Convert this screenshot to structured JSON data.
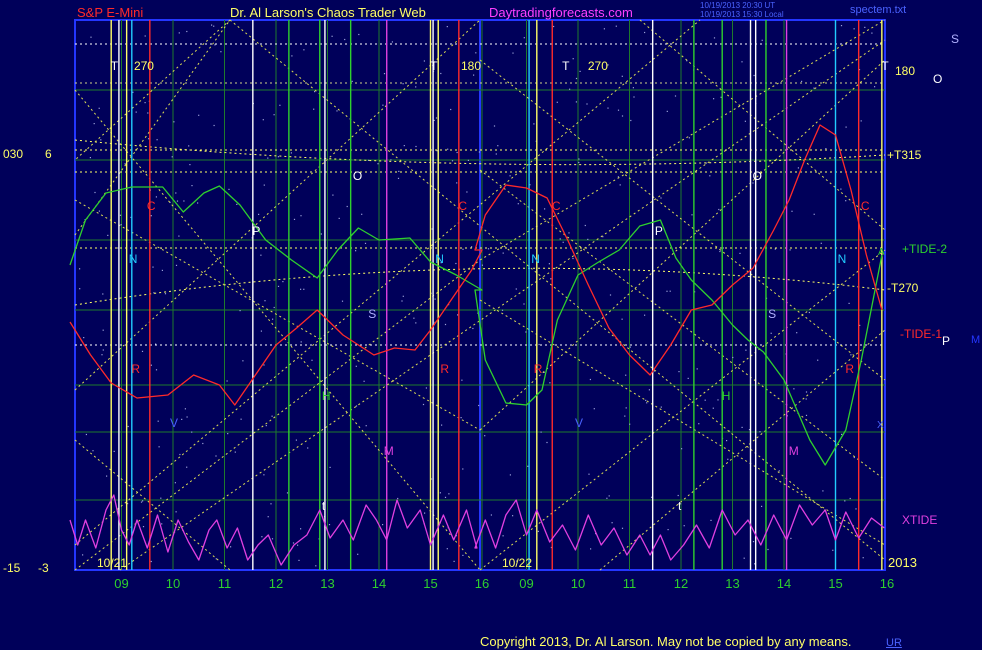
{
  "header": {
    "instrument": "S&P E-Mini",
    "title": "Dr. Al Larson's Chaos Trader Web",
    "site": "Daytradingforecasts.com",
    "stamp1": "10/19/2013 20:30 UT",
    "stamp2": "10/19/2013 15:30 Local",
    "file": "spectem.txt"
  },
  "footer": {
    "copyright": "Copyright 2013, Dr. Al Larson. May not be copied by any means.",
    "link": "UR"
  },
  "colors": {
    "background": "#00005a",
    "frame": "#2436ff",
    "grid": "#1e7a2c",
    "yellow": "#ffff66",
    "red": "#ff2a2a",
    "green": "#2ed02e",
    "magenta": "#e040e0",
    "cyan": "#22ccff",
    "white": "#ffffff"
  },
  "chart_data": {
    "type": "line",
    "x_ticks": [
      "09",
      "10",
      "11",
      "12",
      "13",
      "14",
      "15",
      "16",
      "09",
      "10",
      "11",
      "12",
      "13",
      "14",
      "15",
      "16"
    ],
    "dates": [
      "10/21",
      "10/22"
    ],
    "year": "2013",
    "left_axis": {
      "top_labels": [
        "030",
        "6"
      ],
      "bottom_labels": [
        "-15",
        "-3"
      ]
    },
    "right_labels": {
      "t315": "+T315",
      "tide2": "+TIDE-2",
      "t270": "-T270",
      "tide1": "-TIDE-1",
      "xtide": "XTIDE",
      "s": "S",
      "o": "O",
      "p": "P",
      "m": "M",
      "a": "A",
      "x": "X",
      "t180": "180"
    },
    "vertical_letters": [
      {
        "text": "T",
        "color": "#ffffff",
        "day": 0,
        "hour": 8.85,
        "y": 70
      },
      {
        "text": "270",
        "color": "#ffff66",
        "day": 0,
        "hour": 9.3,
        "y": 70
      },
      {
        "text": "T",
        "color": "#ffffff",
        "day": 0,
        "hour": 15.05,
        "y": 70
      },
      {
        "text": "180",
        "color": "#ffff66",
        "day": 0,
        "hour": 15.65,
        "y": 70
      },
      {
        "text": "T",
        "color": "#ffffff",
        "day": 1,
        "hour": 9.75,
        "y": 70
      },
      {
        "text": "270",
        "color": "#ffff66",
        "day": 1,
        "hour": 10.25,
        "y": 70
      },
      {
        "text": "T",
        "color": "#ffffff",
        "day": 1,
        "hour": 15.95,
        "y": 70
      },
      {
        "text": "O",
        "color": "#ffffff",
        "day": 0,
        "hour": 13.55,
        "y": 180
      },
      {
        "text": "O",
        "color": "#ffffff",
        "day": 1,
        "hour": 13.45,
        "y": 180
      },
      {
        "text": "C",
        "color": "#ff2a2a",
        "day": 0,
        "hour": 9.55,
        "y": 210
      },
      {
        "text": "C",
        "color": "#ff2a2a",
        "day": 0,
        "hour": 15.6,
        "y": 210
      },
      {
        "text": "C",
        "color": "#ff2a2a",
        "day": 1,
        "hour": 9.55,
        "y": 210
      },
      {
        "text": "C",
        "color": "#ff2a2a",
        "day": 1,
        "hour": 15.55,
        "y": 210
      },
      {
        "text": "P",
        "color": "#ffffff",
        "day": 0,
        "hour": 11.6,
        "y": 235
      },
      {
        "text": "P",
        "color": "#ffffff",
        "day": 1,
        "hour": 11.55,
        "y": 235
      },
      {
        "text": "N",
        "color": "#22ccff",
        "day": 0,
        "hour": 9.2,
        "y": 263
      },
      {
        "text": "N",
        "color": "#22ccff",
        "day": 0,
        "hour": 15.15,
        "y": 263
      },
      {
        "text": "N",
        "color": "#22ccff",
        "day": 1,
        "hour": 9.15,
        "y": 263
      },
      {
        "text": "N",
        "color": "#22ccff",
        "day": 1,
        "hour": 15.1,
        "y": 263
      },
      {
        "text": "S",
        "color": "#b0b0ff",
        "day": 0,
        "hour": 13.85,
        "y": 318
      },
      {
        "text": "S",
        "color": "#b0b0ff",
        "day": 1,
        "hour": 13.75,
        "y": 318
      },
      {
        "text": "R",
        "color": "#ff2a2a",
        "day": 0,
        "hour": 9.25,
        "y": 373
      },
      {
        "text": "R",
        "color": "#ff2a2a",
        "day": 0,
        "hour": 15.25,
        "y": 373
      },
      {
        "text": "R",
        "color": "#ff2a2a",
        "day": 1,
        "hour": 9.2,
        "y": 373
      },
      {
        "text": "R",
        "color": "#ff2a2a",
        "day": 1,
        "hour": 15.25,
        "y": 373
      },
      {
        "text": "H",
        "color": "#2ed02e",
        "day": 0,
        "hour": 12.95,
        "y": 400
      },
      {
        "text": "H",
        "color": "#2ed02e",
        "day": 1,
        "hour": 12.85,
        "y": 400
      },
      {
        "text": "V",
        "color": "#4a62ff",
        "day": 0,
        "hour": 10.0,
        "y": 427
      },
      {
        "text": "V",
        "color": "#4a62ff",
        "day": 1,
        "hour": 10.0,
        "y": 427
      },
      {
        "text": "M",
        "color": "#e040e0",
        "day": 0,
        "hour": 14.15,
        "y": 455
      },
      {
        "text": "M",
        "color": "#e040e0",
        "day": 1,
        "hour": 14.15,
        "y": 455
      },
      {
        "text": "t",
        "color": "#ffffff",
        "day": 0,
        "hour": 12.95,
        "y": 510
      },
      {
        "text": "t",
        "color": "#ffffff",
        "day": 1,
        "hour": 12.0,
        "y": 510
      }
    ],
    "vlines": [
      {
        "color": "#ffff66",
        "day": 0,
        "hour": 8.8
      },
      {
        "color": "#ffffff",
        "day": 0,
        "hour": 8.95
      },
      {
        "color": "#ffff66",
        "day": 0,
        "hour": 9.1
      },
      {
        "color": "#22ccff",
        "day": 0,
        "hour": 9.2
      },
      {
        "color": "#ff2a2a",
        "day": 0,
        "hour": 9.55
      },
      {
        "color": "#ffffff",
        "day": 0,
        "hour": 11.55
      },
      {
        "color": "#2ed02e",
        "day": 0,
        "hour": 12.25
      },
      {
        "color": "#2ed02e",
        "day": 0,
        "hour": 12.85
      },
      {
        "color": "#ffffff",
        "day": 0,
        "hour": 12.95
      },
      {
        "color": "#2ed02e",
        "day": 0,
        "hour": 13.45
      },
      {
        "color": "#e040e0",
        "day": 0,
        "hour": 14.15
      },
      {
        "color": "#ffff66",
        "day": 0,
        "hour": 15.0
      },
      {
        "color": "#ffffff",
        "day": 0,
        "hour": 15.05
      },
      {
        "color": "#ffff66",
        "day": 0,
        "hour": 15.15
      },
      {
        "color": "#ff2a2a",
        "day": 0,
        "hour": 15.55
      },
      {
        "color": "#22ccff",
        "day": 1,
        "hour": 9.05
      },
      {
        "color": "#ffff66",
        "day": 1,
        "hour": 9.2
      },
      {
        "color": "#ff2a2a",
        "day": 1,
        "hour": 9.5
      },
      {
        "color": "#ffffff",
        "day": 1,
        "hour": 11.45
      },
      {
        "color": "#2ed02e",
        "day": 1,
        "hour": 12.25
      },
      {
        "color": "#2ed02e",
        "day": 1,
        "hour": 12.8
      },
      {
        "color": "#ffffff",
        "day": 1,
        "hour": 13.35
      },
      {
        "color": "#ffffff",
        "day": 1,
        "hour": 13.45
      },
      {
        "color": "#2ed02e",
        "day": 1,
        "hour": 13.65
      },
      {
        "color": "#e040e0",
        "day": 1,
        "hour": 14.05
      },
      {
        "color": "#22ccff",
        "day": 1,
        "hour": 15.0
      },
      {
        "color": "#ff2a2a",
        "day": 1,
        "hour": 15.45
      },
      {
        "color": "#ffff66",
        "day": 1,
        "hour": 15.9
      }
    ],
    "series": [
      {
        "color": "#2ed02e",
        "day1": [
          [
            8.0,
            265
          ],
          [
            8.3,
            220
          ],
          [
            8.7,
            193
          ],
          [
            9.2,
            187
          ],
          [
            9.8,
            187
          ],
          [
            10.2,
            212
          ],
          [
            10.6,
            193
          ],
          [
            10.9,
            186
          ],
          [
            11.3,
            205
          ],
          [
            11.8,
            240
          ],
          [
            12.3,
            260
          ],
          [
            12.8,
            278
          ],
          [
            13.2,
            250
          ],
          [
            13.6,
            228
          ],
          [
            14.0,
            240
          ],
          [
            14.6,
            238
          ],
          [
            15.0,
            262
          ],
          [
            15.5,
            275
          ],
          [
            16.0,
            290
          ]
        ],
        "day2": [
          [
            8.0,
            290
          ],
          [
            8.2,
            360
          ],
          [
            8.6,
            403
          ],
          [
            9.0,
            405
          ],
          [
            9.3,
            390
          ],
          [
            9.6,
            320
          ],
          [
            10.0,
            275
          ],
          [
            10.4,
            262
          ],
          [
            10.8,
            250
          ],
          [
            11.2,
            226
          ],
          [
            11.6,
            220
          ],
          [
            11.9,
            258
          ],
          [
            12.2,
            280
          ],
          [
            12.6,
            300
          ],
          [
            13.0,
            325
          ],
          [
            13.3,
            340
          ],
          [
            13.6,
            352
          ],
          [
            14.0,
            380
          ],
          [
            14.5,
            440
          ],
          [
            14.8,
            465
          ],
          [
            15.2,
            430
          ],
          [
            15.5,
            360
          ],
          [
            15.9,
            255
          ]
        ]
      },
      {
        "color": "#ff2a2a",
        "day1": [
          [
            8.0,
            322
          ],
          [
            8.4,
            355
          ],
          [
            8.8,
            383
          ],
          [
            9.3,
            398
          ],
          [
            9.9,
            395
          ],
          [
            10.4,
            375
          ],
          [
            10.9,
            385
          ],
          [
            11.2,
            405
          ],
          [
            11.6,
            375
          ],
          [
            12.0,
            345
          ],
          [
            12.4,
            328
          ],
          [
            12.8,
            310
          ],
          [
            13.3,
            335
          ],
          [
            13.9,
            355
          ],
          [
            14.3,
            348
          ],
          [
            14.7,
            350
          ],
          [
            15.0,
            330
          ],
          [
            15.4,
            300
          ],
          [
            15.8,
            270
          ],
          [
            16.0,
            250
          ]
        ],
        "day2": [
          [
            8.0,
            250
          ],
          [
            8.2,
            215
          ],
          [
            8.6,
            185
          ],
          [
            9.0,
            188
          ],
          [
            9.4,
            198
          ],
          [
            9.8,
            240
          ],
          [
            10.2,
            285
          ],
          [
            10.6,
            328
          ],
          [
            11.0,
            355
          ],
          [
            11.4,
            375
          ],
          [
            11.8,
            345
          ],
          [
            12.2,
            310
          ],
          [
            12.6,
            305
          ],
          [
            13.0,
            285
          ],
          [
            13.4,
            268
          ],
          [
            13.8,
            230
          ],
          [
            14.1,
            200
          ],
          [
            14.4,
            160
          ],
          [
            14.7,
            125
          ],
          [
            15.0,
            135
          ],
          [
            15.3,
            190
          ],
          [
            15.6,
            255
          ],
          [
            15.9,
            310
          ]
        ]
      },
      {
        "color": "#e040e0",
        "day1": [
          [
            8.0,
            520
          ],
          [
            8.15,
            545
          ],
          [
            8.3,
            520
          ],
          [
            8.5,
            548
          ],
          [
            8.7,
            510
          ],
          [
            8.85,
            495
          ],
          [
            9.0,
            530
          ],
          [
            9.15,
            545
          ],
          [
            9.3,
            520
          ],
          [
            9.5,
            548
          ],
          [
            9.7,
            515
          ],
          [
            9.9,
            552
          ],
          [
            10.1,
            520
          ],
          [
            10.3,
            542
          ],
          [
            10.5,
            560
          ],
          [
            10.7,
            530
          ],
          [
            10.85,
            520
          ],
          [
            11.05,
            548
          ],
          [
            11.25,
            528
          ],
          [
            11.45,
            560
          ],
          [
            11.65,
            545
          ],
          [
            11.85,
            535
          ],
          [
            12.1,
            565
          ],
          [
            12.35,
            545
          ],
          [
            12.6,
            535
          ],
          [
            12.85,
            510
          ],
          [
            13.05,
            538
          ],
          [
            13.3,
            520
          ],
          [
            13.5,
            540
          ],
          [
            13.75,
            505
          ],
          [
            13.95,
            520
          ],
          [
            14.15,
            540
          ],
          [
            14.35,
            500
          ],
          [
            14.55,
            528
          ],
          [
            14.8,
            510
          ],
          [
            15.0,
            545
          ],
          [
            15.25,
            515
          ],
          [
            15.45,
            540
          ],
          [
            15.7,
            510
          ],
          [
            15.9,
            548
          ]
        ],
        "day2": [
          [
            8.0,
            548
          ],
          [
            8.2,
            520
          ],
          [
            8.4,
            548
          ],
          [
            8.6,
            515
          ],
          [
            8.8,
            500
          ],
          [
            9.0,
            535
          ],
          [
            9.2,
            510
          ],
          [
            9.45,
            542
          ],
          [
            9.7,
            525
          ],
          [
            9.95,
            550
          ],
          [
            10.2,
            515
          ],
          [
            10.45,
            545
          ],
          [
            10.7,
            528
          ],
          [
            10.95,
            555
          ],
          [
            11.2,
            535
          ],
          [
            11.4,
            555
          ],
          [
            11.6,
            535
          ],
          [
            11.8,
            560
          ],
          [
            12.05,
            545
          ],
          [
            12.3,
            525
          ],
          [
            12.55,
            548
          ],
          [
            12.8,
            510
          ],
          [
            13.05,
            535
          ],
          [
            13.3,
            520
          ],
          [
            13.55,
            545
          ],
          [
            13.8,
            515
          ],
          [
            14.05,
            540
          ],
          [
            14.3,
            505
          ],
          [
            14.55,
            525
          ],
          [
            14.8,
            510
          ],
          [
            15.0,
            540
          ],
          [
            15.2,
            512
          ],
          [
            15.45,
            538
          ],
          [
            15.7,
            518
          ],
          [
            15.95,
            528
          ]
        ]
      }
    ]
  }
}
